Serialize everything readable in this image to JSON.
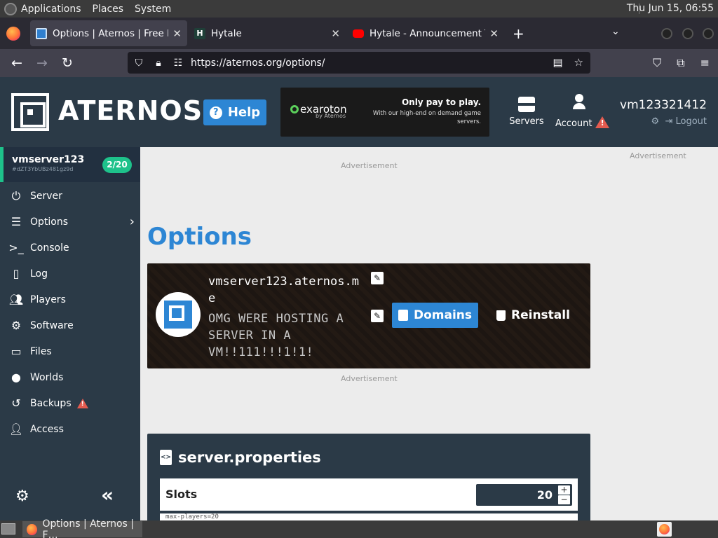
{
  "os": {
    "menus": [
      "Applications",
      "Places",
      "System"
    ],
    "clock": "Thu Jun 15, 06:55"
  },
  "browser": {
    "tabs": [
      {
        "title": "Options | Aternos | Free Min",
        "favicon": "aternos-icon",
        "active": true
      },
      {
        "title": "Hytale",
        "favicon": "hytale-icon",
        "active": false
      },
      {
        "title": "Hytale - Announcement Tra",
        "favicon": "youtube-icon",
        "active": false
      }
    ],
    "url": "https://aternos.org/options/"
  },
  "header": {
    "brand": "ATERNOS",
    "help_label": "Help",
    "ad": {
      "brand": "exaroton",
      "brand_sub": "by Aternos",
      "tagline": "Only pay to play.",
      "subtext": "With our high-end on demand game servers."
    },
    "servers_label": "Servers",
    "account_label": "Account",
    "username": "vm123321412",
    "logout_label": "Logout"
  },
  "sidebar": {
    "server_name": "vmserver123",
    "server_id": "#dZT3YbUBz481gz9d",
    "player_badge": "2/20",
    "items": [
      {
        "label": "Server",
        "icon": "power-icon"
      },
      {
        "label": "Options",
        "icon": "sliders-icon"
      },
      {
        "label": "Console",
        "icon": "terminal-icon"
      },
      {
        "label": "Log",
        "icon": "log-icon"
      },
      {
        "label": "Players",
        "icon": "users-icon"
      },
      {
        "label": "Software",
        "icon": "gears-icon"
      },
      {
        "label": "Files",
        "icon": "folder-icon"
      },
      {
        "label": "Worlds",
        "icon": "globe-icon"
      },
      {
        "label": "Backups",
        "icon": "history-icon"
      },
      {
        "label": "Access",
        "icon": "user-gear-icon"
      }
    ]
  },
  "main": {
    "ad_label": "Advertisement",
    "title": "Options",
    "address": "vmserver123.aternos.me",
    "motd": "OMG WERE HOSTING A SERVER IN A VM!!111!!!1!1!",
    "domains_label": "Domains",
    "reinstall_label": "Reinstall",
    "props_title": "server.properties",
    "slots_label": "Slots",
    "slots_value": "20",
    "slots_key": "max-players=20"
  },
  "colors": {
    "brand_blue": "#2d86d4",
    "dark_panel": "#2b3a47",
    "online_green": "#1ec28b",
    "warning_red": "#e45b4f"
  }
}
